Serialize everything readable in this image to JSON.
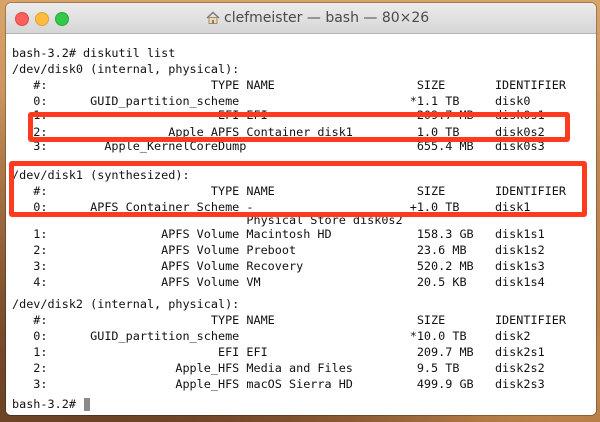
{
  "window": {
    "title": "clefmeister — bash — 80×26"
  },
  "terminal": {
    "lines": [
      {
        "text": "bash-3.2# diskutil list"
      },
      {
        "text": "/dev/disk0 (internal, physical):"
      },
      {
        "text": "   #:                       TYPE NAME                    SIZE       IDENTIFIER"
      },
      {
        "text": "   0:      GUID_partition_scheme                        *1.1 TB     disk0"
      },
      {
        "text": "   1:                        EFI EFI                     209.7 MB   disk0s1"
      },
      {
        "text": "   2:                 Apple_APFS Container disk1         1.0 TB     disk0s2"
      },
      {
        "text": "   3:        Apple_KernelCoreDump                        655.4 MB   disk0s3"
      },
      {
        "text": ""
      },
      {
        "text": "/dev/disk1 (synthesized):"
      },
      {
        "text": "   #:                       TYPE NAME                    SIZE       IDENTIFIER"
      },
      {
        "text": "   0:      APFS Container Scheme -                      +1.0 TB     disk1"
      },
      {
        "text": "                                 Physical Store disk0s2"
      },
      {
        "text": "   1:                APFS Volume Macintosh HD            158.3 GB   disk1s1"
      },
      {
        "text": "   2:                APFS Volume Preboot                 23.6 MB    disk1s2"
      },
      {
        "text": "   3:                APFS Volume Recovery                520.2 MB   disk1s3"
      },
      {
        "text": "   4:                APFS Volume VM                      20.5 KB    disk1s4"
      },
      {
        "text": ""
      },
      {
        "text": "/dev/disk2 (internal, physical):"
      },
      {
        "text": "   #:                       TYPE NAME                    SIZE       IDENTIFIER"
      },
      {
        "text": "   0:      GUID_partition_scheme                        *10.0 TB    disk2"
      },
      {
        "text": "   1:                        EFI EFI                     209.7 MB   disk2s1"
      },
      {
        "text": "   2:                  Apple_HFS Media and Files         9.5 TB     disk2s2"
      },
      {
        "text": "   3:                  Apple_HFS macOS Sierra HD         499.9 GB   disk2s3"
      },
      {
        "text": ""
      },
      {
        "text": "bash-3.2# "
      }
    ]
  },
  "colors": {
    "highlight": "#ff3b1f"
  }
}
